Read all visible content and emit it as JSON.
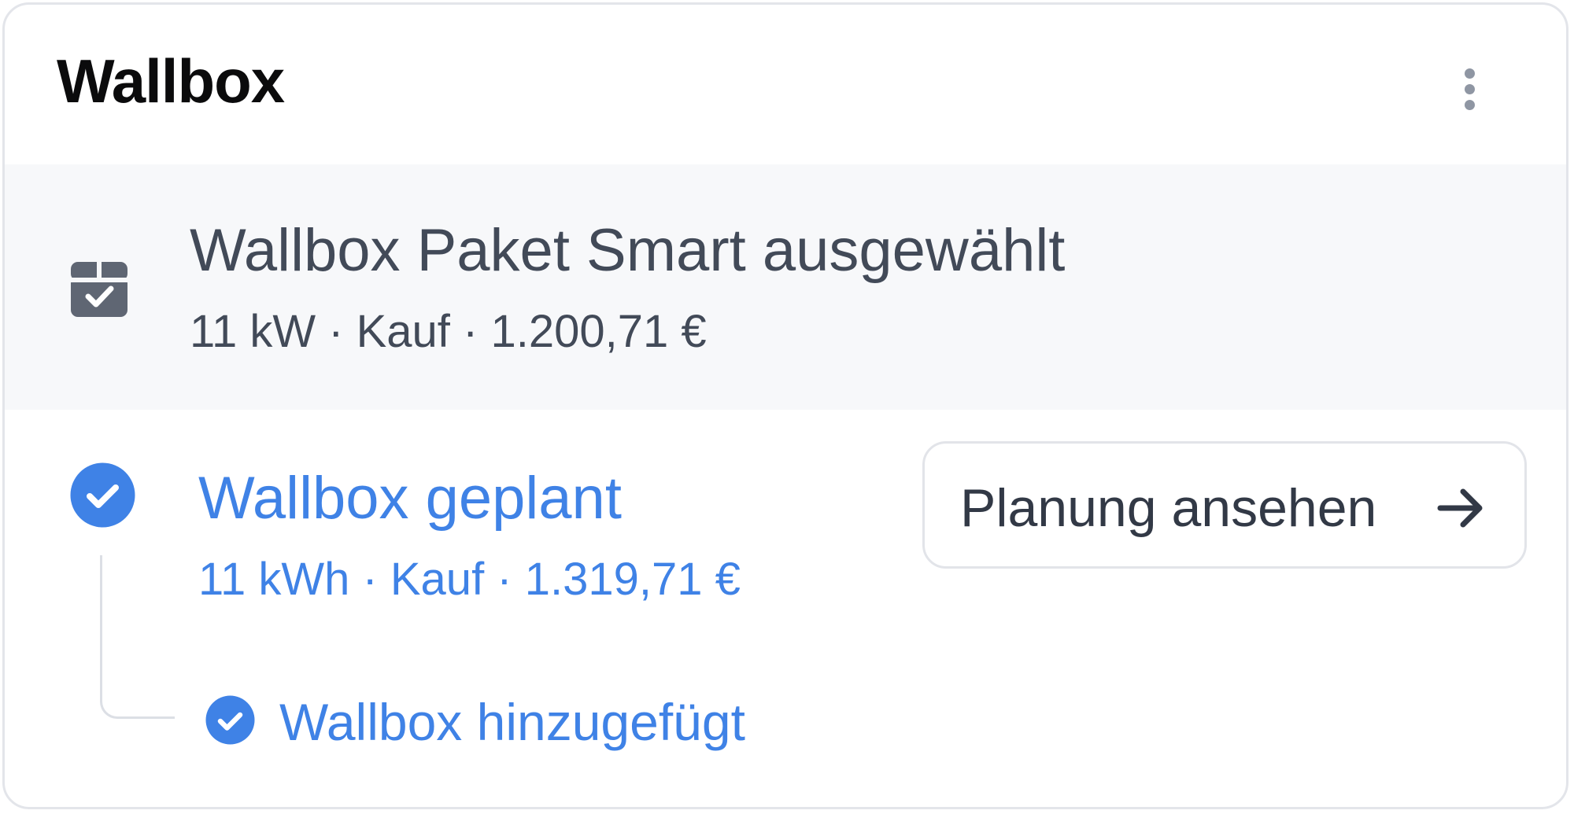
{
  "card": {
    "title": "Wallbox"
  },
  "icons": {
    "menu": "more-vertical-icon",
    "package": "package-check-icon",
    "planned_status": "check-circle-icon",
    "arrow": "arrow-right-icon",
    "added_status": "check-circle-icon"
  },
  "selected_package": {
    "title": "Wallbox Paket Smart ausgewählt",
    "details": "11 kW · Kauf · 1.200,71 €"
  },
  "planned": {
    "title": "Wallbox geplant",
    "details": "11 kWh · Kauf · 1.319,71 €",
    "button_label": "Planung ansehen"
  },
  "timeline": {
    "added_label": "Wallbox hinzugefügt"
  },
  "colors": {
    "accent": "#3f82e6",
    "text_dark": "#424a58",
    "title": "#0b0b0c",
    "muted_icon": "#5f6673",
    "highlight_bg": "#f7f8fa",
    "border": "#e3e5ea"
  }
}
